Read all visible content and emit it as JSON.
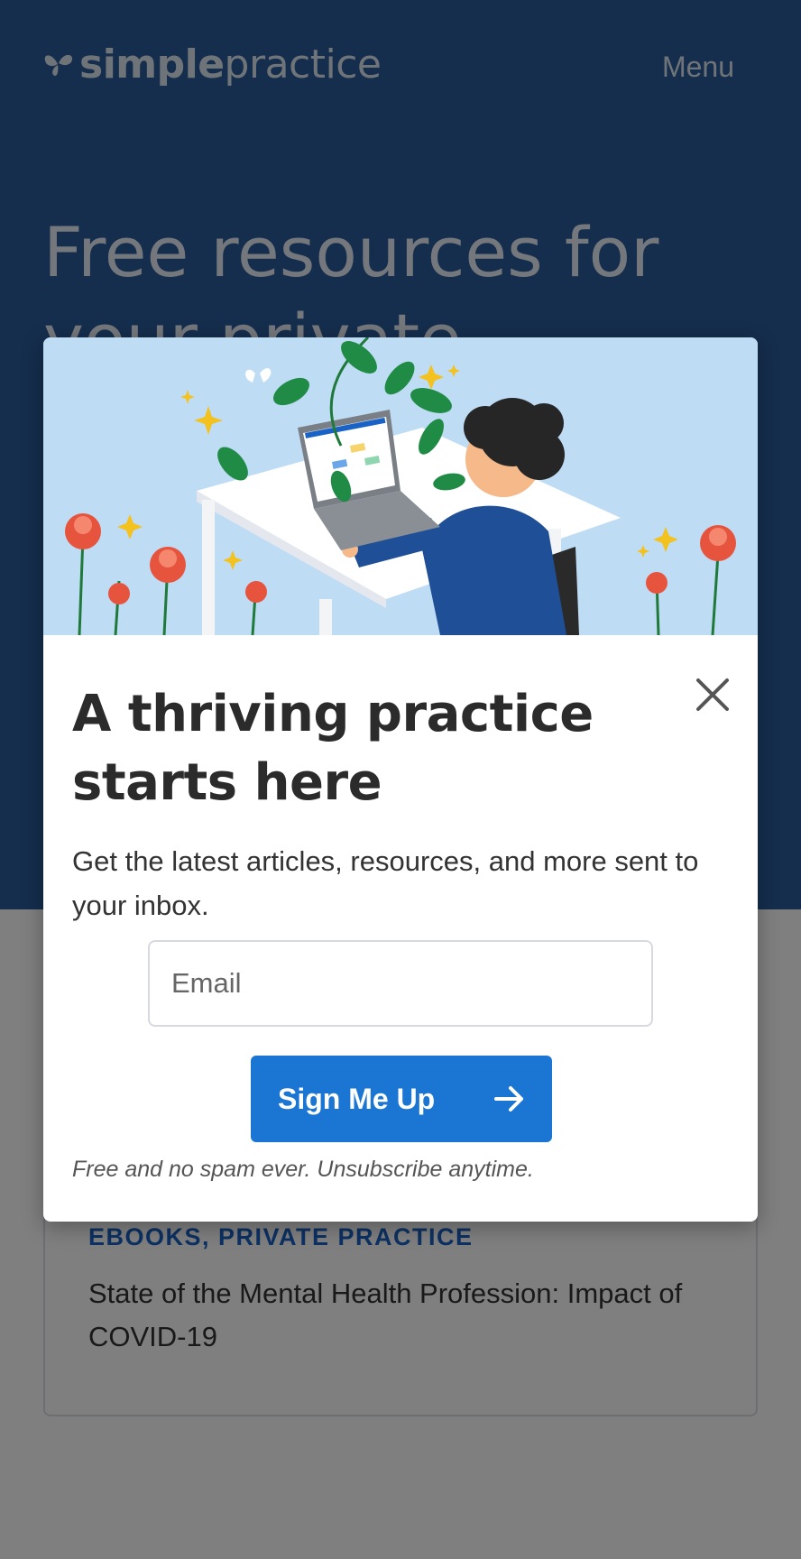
{
  "header": {
    "logo_bold": "simple",
    "logo_light": "practice",
    "menu_label": "Menu"
  },
  "hero": {
    "title": "Free resources for your private"
  },
  "card": {
    "tag": "EBOOKS, PRIVATE PRACTICE",
    "title": "State of the Mental Health Profession: Impact of COVID-19"
  },
  "modal": {
    "title": "A thriving practice starts here",
    "description": "Get the latest articles, resources, and more sent to your inbox.",
    "email_placeholder": "Email",
    "button_label": "Sign Me Up",
    "fineprint": "Free and no spam ever. Unsubscribe anytime."
  },
  "icons": {
    "logo": "butterfly-icon",
    "close": "close-icon",
    "arrow": "arrow-right-icon"
  },
  "colors": {
    "hero_bg": "#2b5c9a",
    "button_bg": "#1a76d2",
    "tag": "#1a63c6",
    "illustration_bg": "#bfdcf5"
  }
}
